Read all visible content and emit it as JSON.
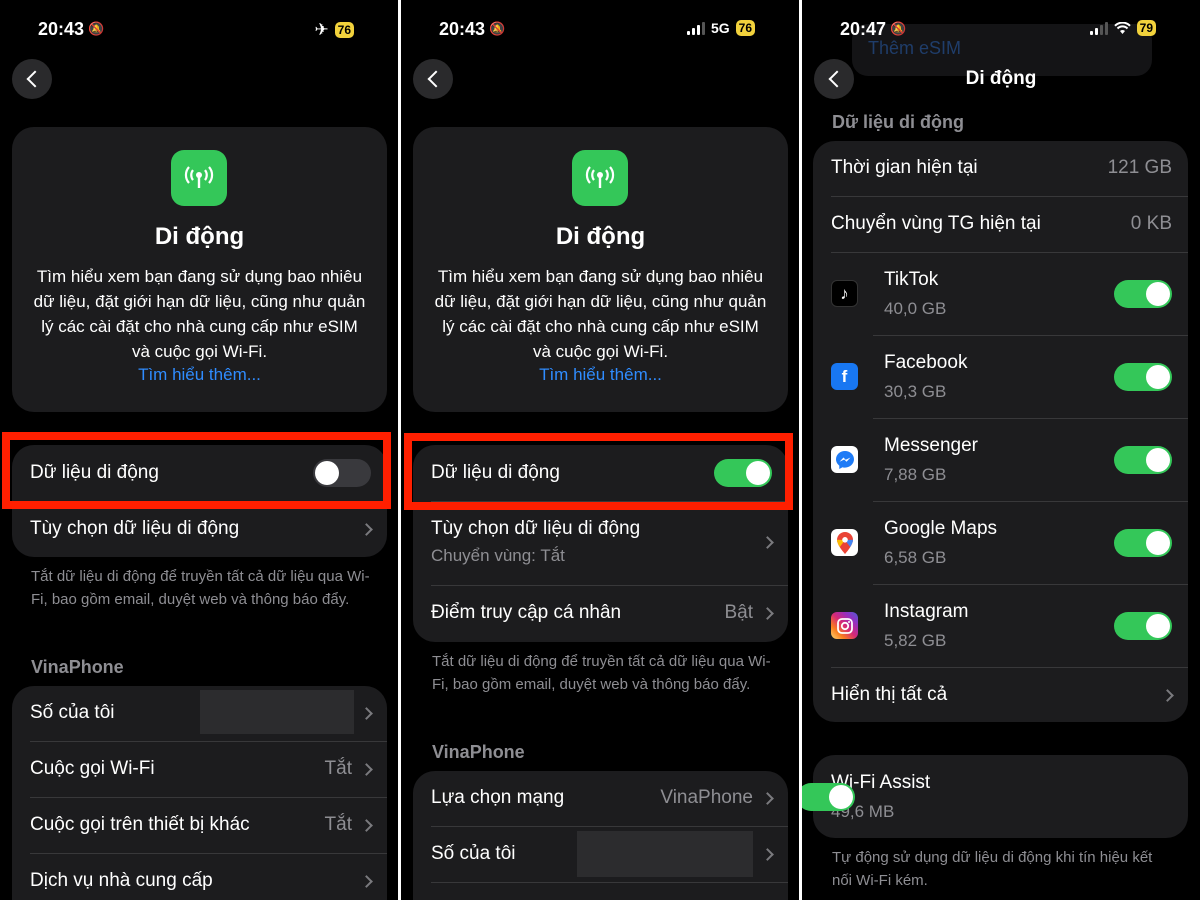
{
  "status": [
    {
      "time": "20:43",
      "net": "",
      "battery": "76"
    },
    {
      "time": "20:43",
      "net": "5G",
      "battery": "76"
    },
    {
      "time": "20:47",
      "net": "",
      "battery": "79"
    }
  ],
  "hero": {
    "title": "Di động",
    "description": "Tìm hiểu xem bạn đang sử dụng bao nhiêu dữ liệu, đặt giới hạn dữ liệu, cũng như quản lý các cài đặt cho nhà cung cấp như eSIM và cuộc gọi Wi-Fi.",
    "link": "Tìm hiểu thêm..."
  },
  "cellular_data_label": "Dữ liệu di động",
  "options_label": "Tùy chọn dữ liệu di động",
  "roaming_sub": "Chuyển vùng: Tắt",
  "hotspot_label": "Điểm truy cập cá nhân",
  "hotspot_value": "Bật",
  "footnote": "Tắt dữ liệu di động để truyền tất cả dữ liệu qua Wi-Fi, bao gồm email, duyệt web và thông báo đẩy.",
  "carrier_header": "VinaPhone",
  "screen1_rows": [
    {
      "label": "Số của tôi",
      "value": ""
    },
    {
      "label": "Cuộc gọi Wi-Fi",
      "value": "Tắt"
    },
    {
      "label": "Cuộc gọi trên thiết bị khác",
      "value": "Tắt"
    },
    {
      "label": "Dịch vụ nhà cung cấp",
      "value": ""
    }
  ],
  "screen2_rows": [
    {
      "label": "Lựa chọn mạng",
      "value": "VinaPhone"
    },
    {
      "label": "Số của tôi",
      "value": ""
    }
  ],
  "screen3": {
    "nav_title": "Di động",
    "behind_text": "Thêm eSIM",
    "section": "Dữ liệu di động",
    "current_period": {
      "label": "Thời gian hiện tại",
      "value": "121 GB"
    },
    "current_roaming": {
      "label": "Chuyển vùng TG hiện tại",
      "value": "0 KB"
    },
    "apps": [
      {
        "name": "TikTok",
        "usage": "40,0 GB",
        "icon": "tiktok-icon",
        "on": true
      },
      {
        "name": "Facebook",
        "usage": "30,3 GB",
        "icon": "facebook-icon",
        "on": true
      },
      {
        "name": "Messenger",
        "usage": "7,88 GB",
        "icon": "messenger-icon",
        "on": true
      },
      {
        "name": "Google Maps",
        "usage": "6,58 GB",
        "icon": "google-maps-icon",
        "on": true
      },
      {
        "name": "Instagram",
        "usage": "5,82 GB",
        "icon": "instagram-icon",
        "on": true
      }
    ],
    "show_all": "Hiển thị tất cả",
    "wifi_assist": {
      "label": "Wi-Fi Assist",
      "usage": "49,6 MB",
      "on": true
    },
    "wifi_assist_note": "Tự động sử dụng dữ liệu di động khi tín hiệu kết nối Wi-Fi kém."
  },
  "colors": {
    "accent_green": "#34c759",
    "link_blue": "#2f8cff",
    "highlight_red": "#ff1f00"
  }
}
